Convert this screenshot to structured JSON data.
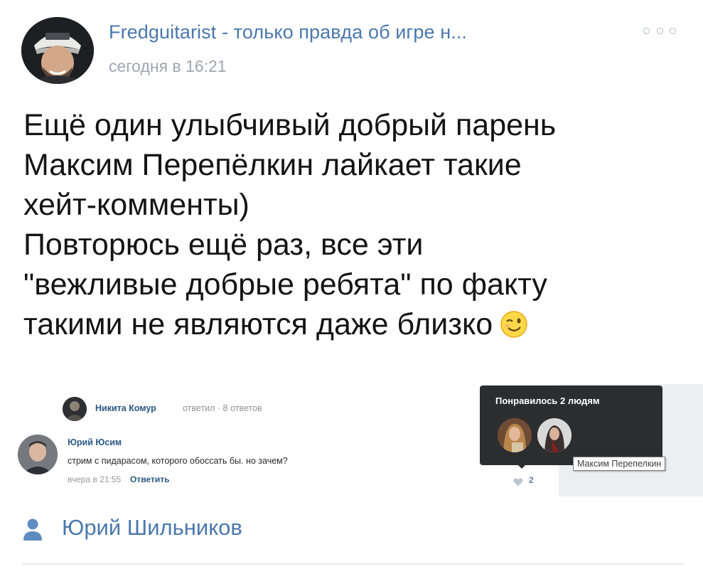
{
  "post": {
    "author": "Fredguitarist - только правда об игре н...",
    "time": "сегодня в 16:21",
    "lines": [
      "Ещё один улыбчивый добрый парень",
      "Максим Перепёлкин лайкает такие",
      "хейт-комменты)",
      "Повторюсь ещё раз, все эти",
      "\"вежливые добрые ребята\" по факту",
      "такими не являются даже близко"
    ],
    "emoji": "wink-emoji"
  },
  "embed": {
    "thread": {
      "name": "Никита Комур",
      "meta": "ответил · 8 ответов"
    },
    "comment": {
      "author": "Юрий Юсим",
      "text": "стрим с пидарасом, которого обоссать бы. но зачем?",
      "time": "вчера в 21:55",
      "reply": "Ответить"
    },
    "likes": {
      "title": "Понравилось 2 людям",
      "hover_name": "Максим Перепелкин",
      "count": "2"
    }
  },
  "footer": {
    "name": "Юрий Шильников"
  },
  "colors": {
    "link": "#4b78ad",
    "vk_link": "#2a5885",
    "tooltip_bg": "#2c2d2f"
  }
}
